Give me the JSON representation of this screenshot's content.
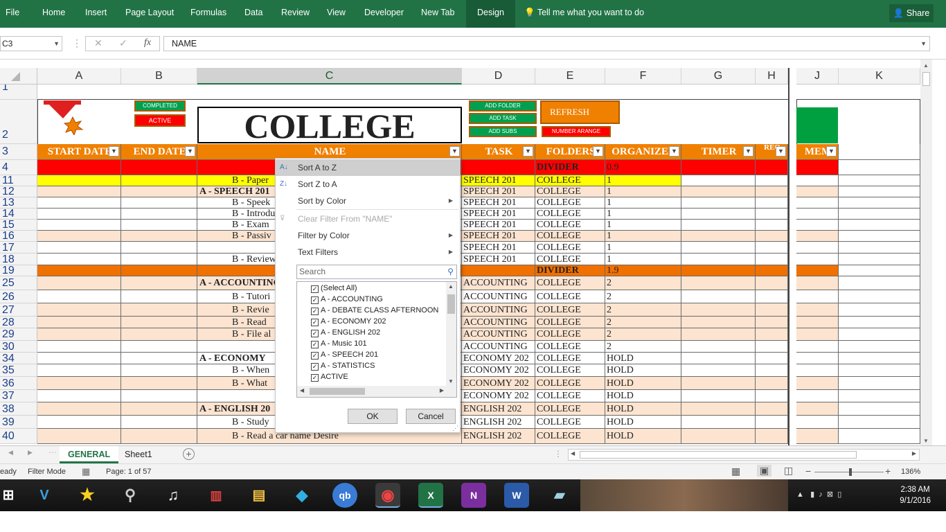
{
  "ribbon": {
    "tabs": [
      "File",
      "Home",
      "Insert",
      "Page Layout",
      "Formulas",
      "Data",
      "Review",
      "View",
      "Developer",
      "New Tab",
      "Design"
    ],
    "tell_me": "Tell me what you want to do",
    "share": "Share"
  },
  "formula_bar": {
    "name_box": "C3",
    "value": "NAME"
  },
  "columns": [
    "A",
    "B",
    "C",
    "D",
    "E",
    "F",
    "G",
    "H",
    "J",
    "K"
  ],
  "top_buttons": {
    "completed": "COMPLETED",
    "active": "ACTIVE",
    "add_folder": "ADD FOLDER",
    "add_task": "ADD TASK",
    "add_subs": "ADD SUBS",
    "refresh": "REFRESH",
    "number_arange": "NUMBER ARANGE"
  },
  "title": "COLLEGE",
  "headers": {
    "start_date": "START DATE",
    "end_date": "END DATE",
    "name": "NAME",
    "task": "TASK",
    "folders": "FOLDERS",
    "organizer": "ORGANIZER",
    "timer": "TIMER",
    "reo": "REO",
    "mem": "MEM"
  },
  "row_numbers": [
    "1",
    "2",
    "3",
    "4",
    "11",
    "12",
    "13",
    "14",
    "15",
    "16",
    "17",
    "18",
    "19",
    "25",
    "26",
    "27",
    "28",
    "29",
    "30",
    "34",
    "35",
    "36",
    "37",
    "38",
    "39",
    "40"
  ],
  "rows": [
    {
      "name": "",
      "task": "",
      "folder": "DIVIDER",
      "org": "0.9"
    },
    {
      "name": "B - Paper",
      "task": "SPEECH 201",
      "folder": "COLLEGE",
      "org": "1"
    },
    {
      "name": "A - SPEECH 201",
      "task": "SPEECH 201",
      "folder": "COLLEGE",
      "org": "1"
    },
    {
      "name": "B - Speek",
      "task": "SPEECH 201",
      "folder": "COLLEGE",
      "org": "1"
    },
    {
      "name": "B - Introdu",
      "task": "SPEECH 201",
      "folder": "COLLEGE",
      "org": "1"
    },
    {
      "name": "B - Exam",
      "task": "SPEECH 201",
      "folder": "COLLEGE",
      "org": "1"
    },
    {
      "name": "B - Passiv",
      "task": "SPEECH 201",
      "folder": "COLLEGE",
      "org": "1"
    },
    {
      "name": "",
      "task": "SPEECH 201",
      "folder": "COLLEGE",
      "org": "1"
    },
    {
      "name": "B - Review",
      "task": "SPEECH 201",
      "folder": "COLLEGE",
      "org": "1"
    },
    {
      "name": "",
      "task": "",
      "folder": "DIVIDER",
      "org": "1.9"
    },
    {
      "name": "A - ACCOUNTING",
      "task": "ACCOUNTING",
      "folder": "COLLEGE",
      "org": "2"
    },
    {
      "name": "B - Tutori",
      "task": "ACCOUNTING",
      "folder": "COLLEGE",
      "org": "2"
    },
    {
      "name": "B - Revie",
      "task": "ACCOUNTING",
      "folder": "COLLEGE",
      "org": "2"
    },
    {
      "name": "B - Read",
      "task": "ACCOUNTING",
      "folder": "COLLEGE",
      "org": "2"
    },
    {
      "name": "B - File al",
      "task": "ACCOUNTING",
      "folder": "COLLEGE",
      "org": "2"
    },
    {
      "name": "",
      "task": "ACCOUNTING",
      "folder": "COLLEGE",
      "org": "2"
    },
    {
      "name": "A - ECONOMY",
      "task": "ECONOMY 202",
      "folder": "COLLEGE",
      "org": "HOLD"
    },
    {
      "name": "B - When",
      "task": "ECONOMY 202",
      "folder": "COLLEGE",
      "org": "HOLD"
    },
    {
      "name": "B - What",
      "task": "ECONOMY 202",
      "folder": "COLLEGE",
      "org": "HOLD"
    },
    {
      "name": "",
      "task": "ECONOMY 202",
      "folder": "COLLEGE",
      "org": "HOLD"
    },
    {
      "name": "A - ENGLISH 20",
      "task": "ENGLISH 202",
      "folder": "COLLEGE",
      "org": "HOLD"
    },
    {
      "name": "B - Study",
      "task": "ENGLISH 202",
      "folder": "COLLEGE",
      "org": "HOLD"
    },
    {
      "name": "B - Read a car name Desire",
      "task": "ENGLISH 202",
      "folder": "COLLEGE",
      "org": "HOLD"
    }
  ],
  "filter_menu": {
    "sort_az": "Sort A to Z",
    "sort_za": "Sort Z to A",
    "sort_color": "Sort by Color",
    "clear_filter": "Clear Filter From \"NAME\"",
    "filter_color": "Filter by Color",
    "text_filters": "Text Filters",
    "search_placeholder": "Search",
    "items": [
      "(Select All)",
      "A - ACCOUNTING",
      "A - DEBATE CLASS AFTERNOON",
      "A - ECONOMY 202",
      "A - ENGLISH 202",
      "A - Music 101",
      "A - SPEECH 201",
      "A - STATISTICS",
      "ACTIVE"
    ],
    "ok": "OK",
    "cancel": "Cancel"
  },
  "sheets": {
    "general": "GENERAL",
    "sheet1": "Sheet1"
  },
  "status": {
    "ready": "eady",
    "mode": "Filter Mode",
    "page": "Page: 1 of 57",
    "zoom": "136%"
  },
  "clock": {
    "time": "2:38 AM",
    "date": "9/1/2016"
  },
  "colors": {
    "excel_green": "#217346",
    "orange": "#f08000",
    "red": "#ff0000",
    "yellow": "#ffff00",
    "peach": "#fce4d0"
  }
}
